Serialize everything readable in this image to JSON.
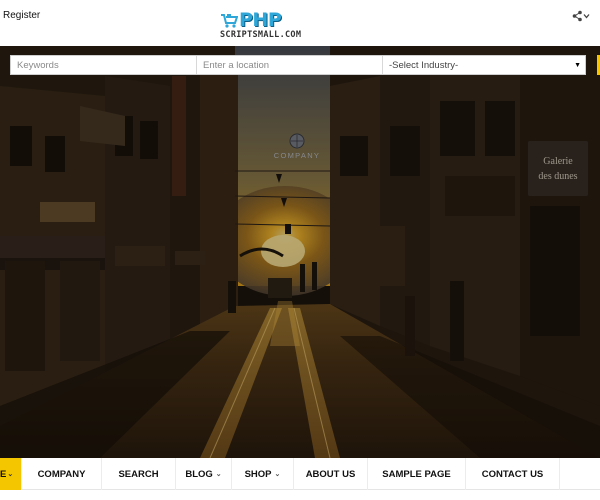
{
  "header": {
    "register_label": "Register",
    "logo_text": "PHP",
    "logo_subtext": "SCRIPTSMALL.COM",
    "share_icon": "share-icon"
  },
  "search": {
    "keywords_placeholder": "Keywords",
    "location_placeholder": "Enter a location",
    "industry_selected": "-Select Industry-"
  },
  "hero": {
    "sign_text": "COMPANY",
    "shop_sign": "Galerie des dunes"
  },
  "nav": {
    "items": [
      {
        "label": "E",
        "has_dropdown": true
      },
      {
        "label": "COMPANY"
      },
      {
        "label": "SEARCH"
      },
      {
        "label": "BLOG",
        "has_dropdown": true
      },
      {
        "label": "SHOP",
        "has_dropdown": true
      },
      {
        "label": "ABOUT US"
      },
      {
        "label": "SAMPLE PAGE"
      },
      {
        "label": "CONTACT US"
      }
    ]
  },
  "colors": {
    "accent": "#f4c600",
    "brand": "#2ea6d8"
  }
}
